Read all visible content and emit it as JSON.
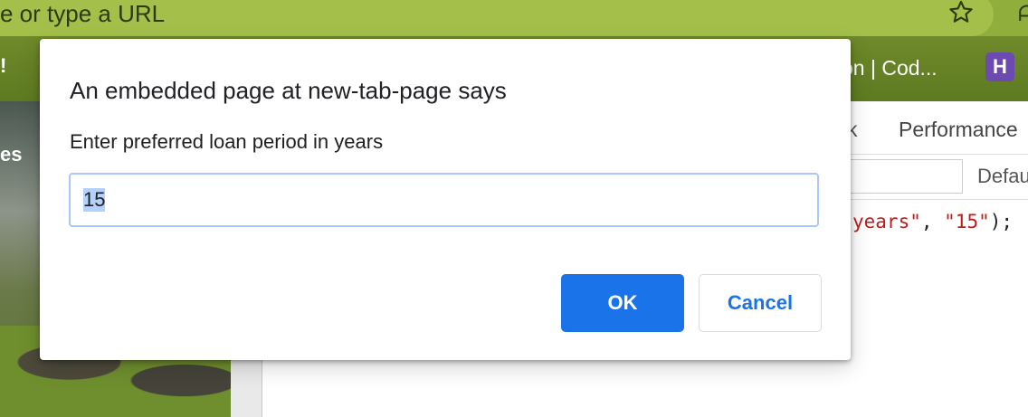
{
  "browser": {
    "omnibox_placeholder": "e or type a URL",
    "ext_glyph": "ᗩ",
    "bookmarks": {
      "left_fragment": "!",
      "right_fragment": "on | Cod...",
      "heroku_letter": "H"
    }
  },
  "page": {
    "fragment": "es"
  },
  "devtools": {
    "tab_partial": "k",
    "tab_performance": "Performance",
    "filter_default": "Defau",
    "code_string1": "years\"",
    "code_sep": ", ",
    "code_string2": "\"15\"",
    "code_end": ");"
  },
  "dialog": {
    "title": "An embedded page at new-tab-page says",
    "message": "Enter preferred loan period in years",
    "input_value": "15",
    "ok_label": "OK",
    "cancel_label": "Cancel"
  },
  "colors": {
    "accent": "#1a73e8",
    "input_focus_border": "#a8c7fa",
    "chrome_theme": "#a4bf4a"
  }
}
